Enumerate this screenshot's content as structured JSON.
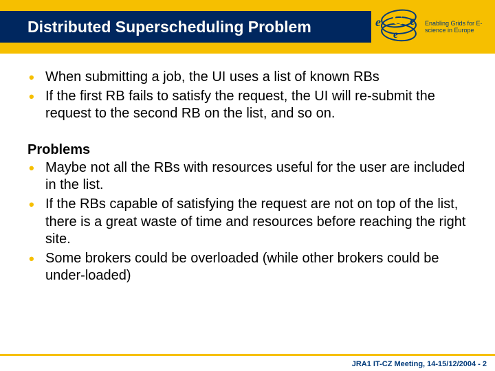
{
  "header": {
    "title": "Distributed Superscheduling Problem",
    "logo": {
      "tagline": "Enabling Grids for E-science in Europe"
    }
  },
  "content": {
    "intro_bullets": [
      "When submitting a job, the UI uses a list of known RBs",
      "If the first RB fails to satisfy the request, the UI will re-submit the request to the second RB on the list, and so on."
    ],
    "section_title": "Problems",
    "problem_bullets": [
      "Maybe not all the RBs with resources useful for the user are included in the list.",
      "If the RBs capable of satisfying the request are not on top of the list, there is a great waste of time and resources before reaching the right site.",
      "Some brokers could be overloaded (while other brokers could be under-loaded)"
    ]
  },
  "footer": {
    "text": "JRA1 IT-CZ Meeting, 14-15/12/2004  - 2"
  }
}
